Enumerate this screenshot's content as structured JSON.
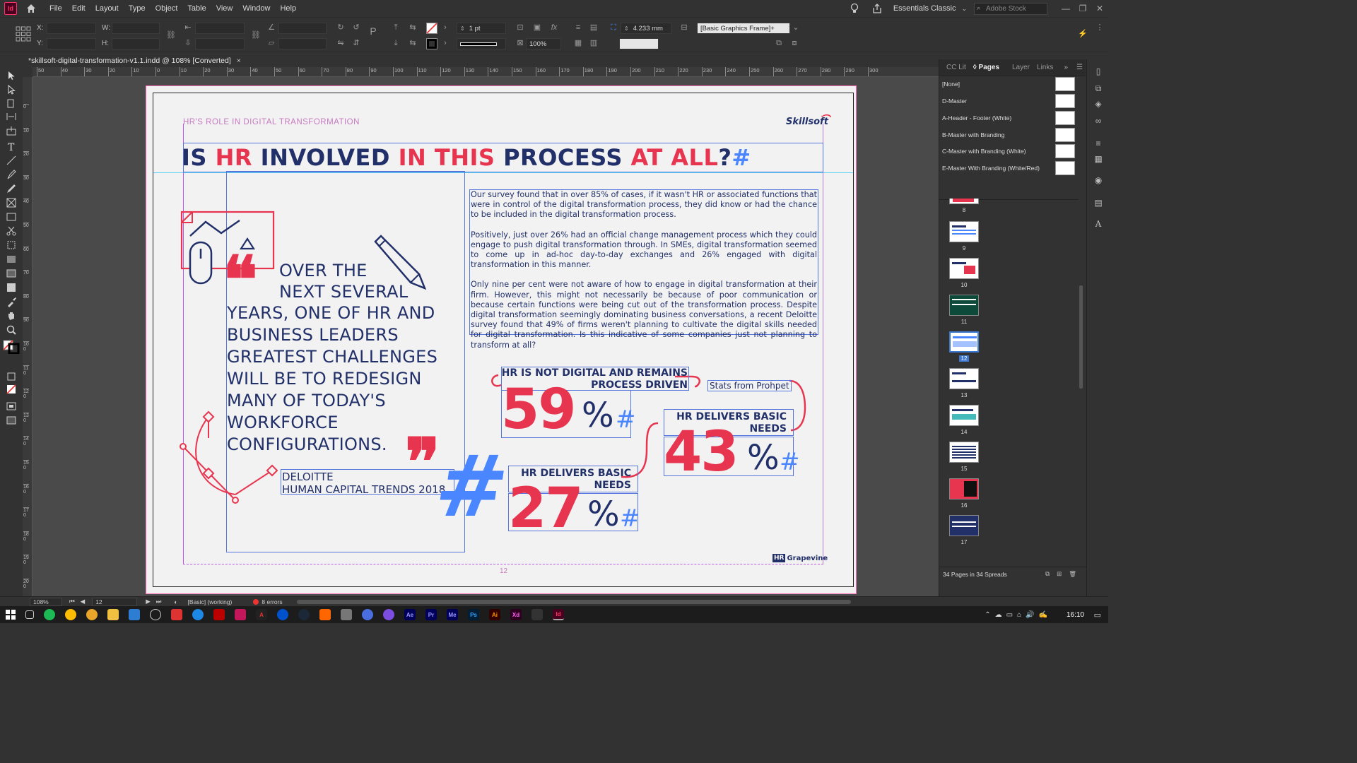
{
  "app": {
    "logo": "Id",
    "menu": [
      "File",
      "Edit",
      "Layout",
      "Type",
      "Object",
      "Table",
      "View",
      "Window",
      "Help"
    ],
    "workspace": "Essentials Classic",
    "stock_placeholder": "Adobe Stock"
  },
  "control": {
    "x_label": "X:",
    "y_label": "Y:",
    "w_label": "W:",
    "h_label": "H:",
    "stroke_weight": "1 pt",
    "scale": "100%",
    "measure": "4.233 mm",
    "object_style": "[Basic Graphics Frame]+"
  },
  "document": {
    "tab_title": "*skillsoft-digital-transformation-v1.1.indd @ 108% [Converted]",
    "close": "×"
  },
  "ruler": {
    "h_ticks": [
      "50",
      "40",
      "30",
      "20",
      "10",
      "0",
      "10",
      "20",
      "30",
      "40",
      "50",
      "60",
      "70",
      "80",
      "90",
      "100",
      "110",
      "120",
      "130",
      "140",
      "150",
      "160",
      "170",
      "180",
      "190",
      "200",
      "210",
      "220",
      "230",
      "240",
      "250",
      "260",
      "270",
      "280",
      "290",
      "300"
    ],
    "v_ticks": [
      "0",
      "1 0",
      "2 0",
      "3 0",
      "4 0",
      "5 0",
      "6 0",
      "7 0",
      "8 0",
      "9 0",
      "1 0 0",
      "1 1 0",
      "1 2 0",
      "1 3 0",
      "1 4 0",
      "1 5 0",
      "1 6 0",
      "1 7 0",
      "1 8 0",
      "1 9 0",
      "2 0 0"
    ]
  },
  "page": {
    "eyebrow": "HR'S ROLE IN DIGITAL TRANSFORMATION",
    "headline": [
      {
        "text": "IS ",
        "color": "navy"
      },
      {
        "text": "HR ",
        "color": "red"
      },
      {
        "text": "INVOLVED ",
        "color": "navy"
      },
      {
        "text": "IN THIS ",
        "color": "red"
      },
      {
        "text": "PROCESS ",
        "color": "navy"
      },
      {
        "text": "AT ALL",
        "color": "red"
      },
      {
        "text": "?",
        "color": "navy"
      },
      {
        "text": "#",
        "color": "blue"
      }
    ],
    "quote_open": "❝",
    "quote_close": "❞",
    "quote_first": "OVER THE",
    "quote_second": "NEXT SEVERAL",
    "quote_rest": "YEARS, ONE OF HR AND BUSINESS LEADERS GREATEST CHALLENGES WILL BE TO REDESIGN MANY OF TODAY'S WORKFORCE CONFIGURATIONS.",
    "quote_source_1": "DELOITTE",
    "quote_source_2": "HUMAN CAPITAL TRENDS 2018",
    "big_hash": "#",
    "paragraphs": [
      "Our survey found that in over 85% of cases, if it wasn't HR or associated functions that were in control of the digital transformation process, they did know or had the chance to be included in the digital transformation process.",
      "Positively, just over 26% had an official change management process which they could engage to push digital transformation through. In SMEs, digital transformation seemed to come up in ad-hoc day-to-day exchanges and 26% engaged with digital transformation in this manner.",
      "Only nine per cent were not aware of how to engage in digital transformation at their firm. However, this might not necessarily be because of poor communication or because certain functions were being cut out of the transformation process. Despite digital transformation seemingly dominating business conversations, a recent Deloitte survey found that 49% of firms weren't planning to cultivate the digital skills needed for digital transformation. Is this indicative of some companies just not planning to transform at all?"
    ],
    "stats_from": "Stats from Prohpet",
    "stats": [
      {
        "heading_1": "HR IS NOT DIGITAL AND REMAINS",
        "heading_2": "PROCESS DRIVEN",
        "number": "59",
        "pct": "%",
        "hash": "#"
      },
      {
        "heading_1": "HR DELIVERS BASIC",
        "heading_2": "NEEDS",
        "number": "43",
        "pct": "%",
        "hash": "#"
      },
      {
        "heading_1": "HR DELIVERS BASIC",
        "heading_2": "NEEDS",
        "number": "27",
        "pct": "%",
        "hash": "#"
      }
    ],
    "logo_top": "Skillsoft",
    "logo_bottom_hr": "HR",
    "logo_bottom_text": "Grapevine",
    "page_number": "12"
  },
  "panel": {
    "tabs": [
      "CC Lit",
      "Pages",
      "Layer",
      "Links"
    ],
    "masters": [
      "[None]",
      "D-Master",
      "A-Header - Footer (White)",
      "B-Master with Branding",
      "C-Master with Branding (White)",
      "E-Master With Branding (White/Red)"
    ],
    "pages": [
      "8",
      "9",
      "10",
      "11",
      "12",
      "13",
      "14",
      "15",
      "16",
      "17"
    ],
    "selected_page": "12",
    "footer": "34 Pages in 34 Spreads"
  },
  "status": {
    "zoom": "108%",
    "page": "12",
    "preflight_profile": "[Basic] (working)",
    "errors": "8 errors"
  },
  "taskbar": {
    "time": "16:10"
  },
  "colors": {
    "navy": "#22306a",
    "red": "#e8354f",
    "blue": "#4a86ff",
    "ui_bg": "#323232"
  }
}
